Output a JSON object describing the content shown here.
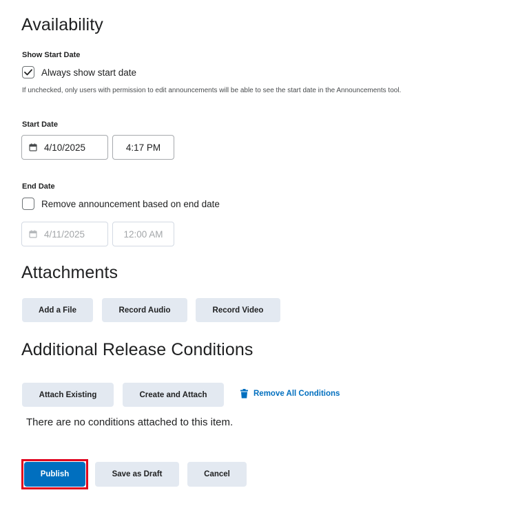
{
  "availability": {
    "heading": "Availability",
    "show_start_date_label": "Show Start Date",
    "always_show_label": "Always show start date",
    "always_show_checked": true,
    "help_text": "If unchecked, only users with permission to edit announcements will be able to see the start date in the Announcements tool.",
    "start_date_label": "Start Date",
    "start_date": "4/10/2025",
    "start_time": "4:17 PM",
    "end_date_label": "End Date",
    "remove_label": "Remove announcement based on end date",
    "remove_checked": false,
    "end_date": "4/11/2025",
    "end_time": "12:00 AM"
  },
  "attachments": {
    "heading": "Attachments",
    "add_file": "Add a File",
    "record_audio": "Record Audio",
    "record_video": "Record Video"
  },
  "release_conditions": {
    "heading": "Additional Release Conditions",
    "attach_existing": "Attach Existing",
    "create_and_attach": "Create and Attach",
    "remove_all": "Remove All Conditions",
    "empty_message": "There are no conditions attached to this item."
  },
  "footer": {
    "publish": "Publish",
    "save_draft": "Save as Draft",
    "cancel": "Cancel"
  },
  "colors": {
    "primary": "#006fbf",
    "button_bg": "#e3e9f1",
    "highlight": "#e0001b"
  },
  "icons": [
    "checkmark-icon",
    "calendar-icon",
    "trash-icon"
  ]
}
